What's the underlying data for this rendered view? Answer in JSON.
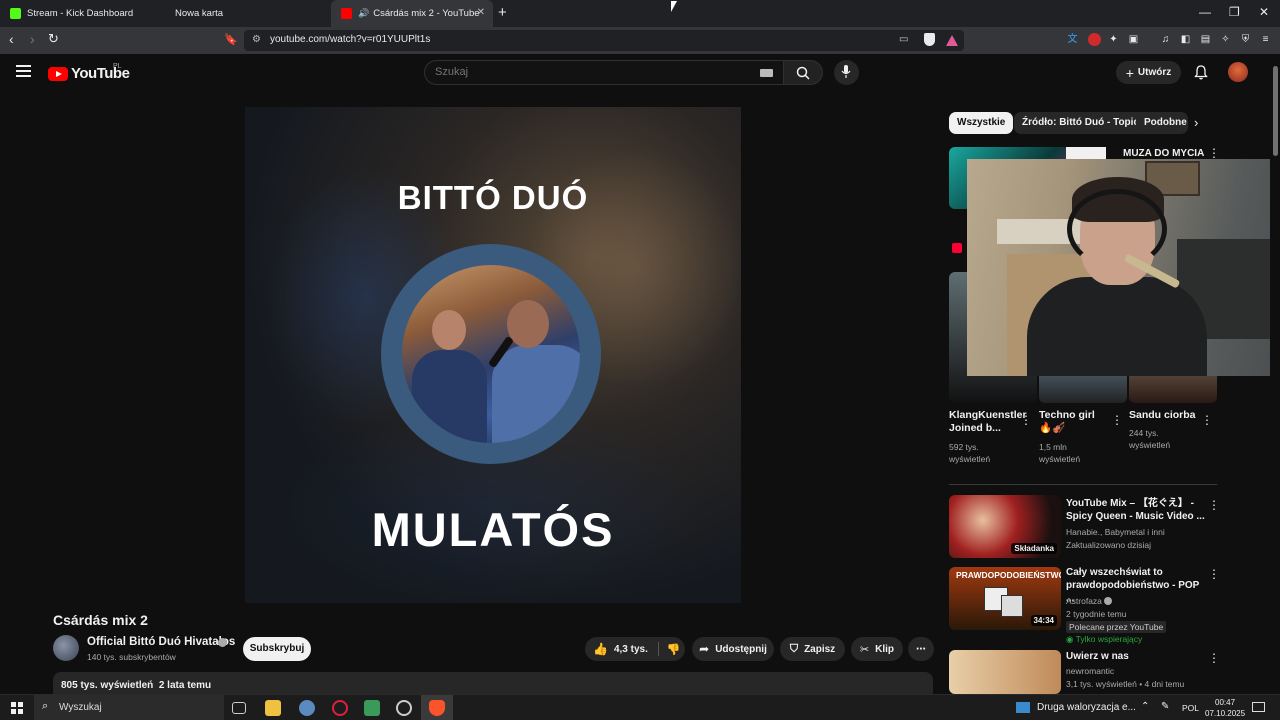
{
  "browser": {
    "tabs": [
      {
        "label": "Stream - Kick Dashboard",
        "favicon_color": "#53fc18"
      },
      {
        "label": "Nowa karta"
      },
      {
        "label": "Csárdás mix 2 - YouTube",
        "favicon_color": "#ff0000",
        "active": true
      }
    ],
    "url": "youtube.com/watch?v=r01YUUPlt1s"
  },
  "youtube": {
    "logo_text": "YouTube",
    "country_code": "PL",
    "search_placeholder": "Szukaj",
    "create_label": "Utwórz"
  },
  "video": {
    "art_artist": "BITTÓ DUÓ",
    "art_title": "MULATÓS",
    "title": "Csárdás mix 2",
    "channel_name": "Official Bittó Duó Hivatalos",
    "subscribers": "140 tys. subskrybentów",
    "subscribe_label": "Subskrybuj",
    "likes": "4,3 tys.",
    "share_label": "Udostępnij",
    "save_label": "Zapisz",
    "clip_label": "Klip",
    "views": "805 tys. wyświetleń",
    "age": "2 lata temu"
  },
  "sidebar": {
    "chips": [
      "Wszystkie",
      "Źródło: Bittó Duó - Topic",
      "Podobne"
    ],
    "top_video_title": "MUZA DO MYCIA",
    "shorts": [
      {
        "title": "KlangKuenstler Joined b...",
        "meta": "592 tys. wyświetleń"
      },
      {
        "title": "Techno girl 🔥🎻",
        "meta": "1,5 mln wyświetleń"
      },
      {
        "title": "Sandu ciorba",
        "meta": "244 tys. wyświetleń"
      }
    ],
    "videos": [
      {
        "title": "YouTube Mix – 【花ぐえ】 - Spicy Queen - Music Video ...",
        "channel": "Hanabie., Babymetal i inni",
        "meta": "Zaktualizowano dzisiaj",
        "badge": "Składanka"
      },
      {
        "title": "Cały wszechświat to prawdopodobieństwo - POP ...",
        "channel": "Astrofaza",
        "meta": "2 tygodnie temu",
        "extra1": "Polecane przez YouTube",
        "extra2": "Tylko wspierający",
        "duration": "34:34",
        "thumb_text": "PRAWDOPODOBIEŃSTWO"
      },
      {
        "title": "Uwierz w nas",
        "channel": "newromantic",
        "meta": "3,1 tys. wyświetleń • 4 dni temu"
      }
    ]
  },
  "taskbar": {
    "search_label": "Wyszukaj",
    "tray_notice": "Druga waloryzacja e...",
    "language": "POL",
    "time": "00:47",
    "date": "07.10.2025"
  }
}
